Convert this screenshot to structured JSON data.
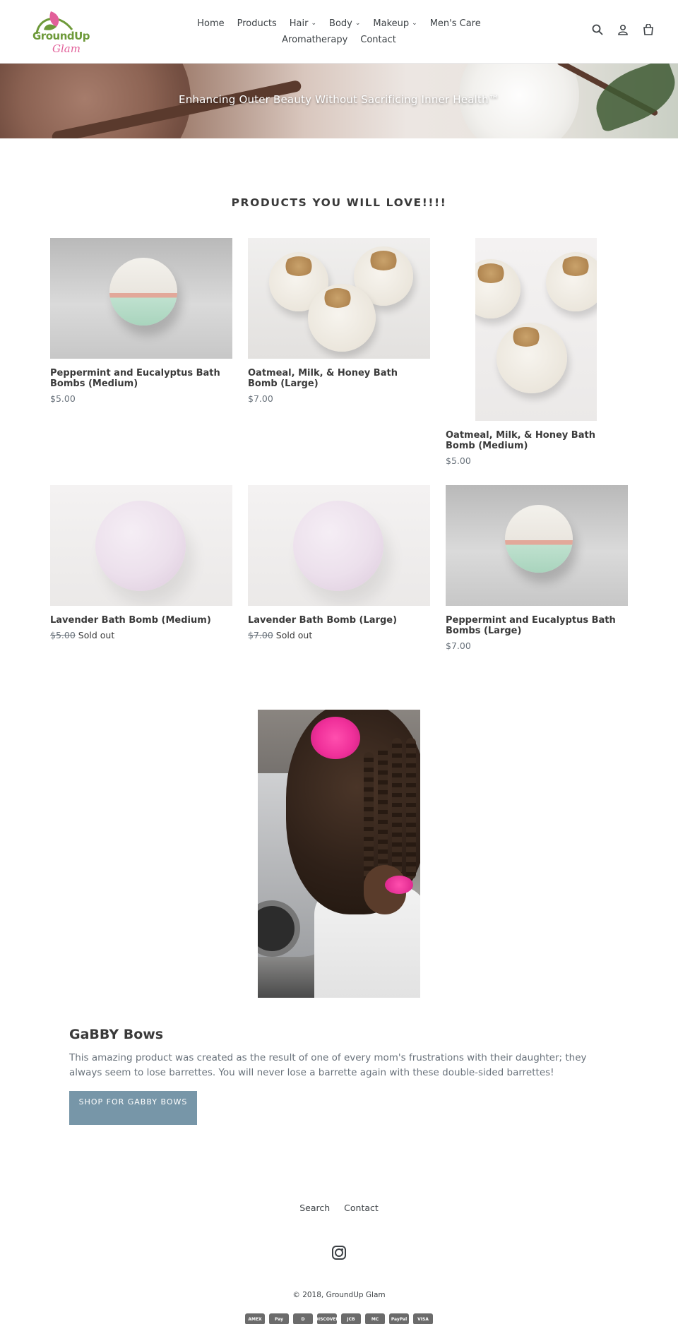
{
  "brand": {
    "logo_line1": "GroundUp",
    "logo_line2": "Glam"
  },
  "nav": {
    "items": [
      {
        "label": "Home",
        "dropdown": false
      },
      {
        "label": "Products",
        "dropdown": false
      },
      {
        "label": "Hair",
        "dropdown": true
      },
      {
        "label": "Body",
        "dropdown": true
      },
      {
        "label": "Makeup",
        "dropdown": true
      },
      {
        "label": "Men's Care",
        "dropdown": false
      },
      {
        "label": "Aromatherapy",
        "dropdown": false
      },
      {
        "label": "Contact",
        "dropdown": false
      }
    ]
  },
  "header_icons": [
    "search-icon",
    "account-icon",
    "cart-icon"
  ],
  "hero": {
    "text": "Enhancing Outer Beauty Without Sacrificing Inner Health™"
  },
  "products_section": {
    "title": "PRODUCTS YOU WILL LOVE!!!!",
    "products": [
      {
        "title": "Peppermint and Eucalyptus Bath Bombs (Medium)",
        "price": "$5.00",
        "compare_price": "",
        "status": ""
      },
      {
        "title": "Oatmeal, Milk, & Honey Bath Bomb (Large)",
        "price": "$7.00",
        "compare_price": "",
        "status": ""
      },
      {
        "title": "Oatmeal, Milk, & Honey Bath Bomb (Medium)",
        "price": "$5.00",
        "compare_price": "",
        "status": ""
      },
      {
        "title": "Lavender Bath Bomb (Medium)",
        "price": "",
        "compare_price": "$5.00",
        "status": "Sold out"
      },
      {
        "title": "Lavender Bath Bomb (Large)",
        "price": "",
        "compare_price": "$7.00",
        "status": "Sold out"
      },
      {
        "title": "Peppermint and Eucalyptus Bath Bombs (Large)",
        "price": "$7.00",
        "compare_price": "",
        "status": ""
      }
    ]
  },
  "feature": {
    "title": "GaBBY Bows",
    "text": "This amazing product was created as the result of one of every mom's frustrations with their daughter; they always seem to lose barrettes.  You will never lose a barrette again with these double-sided barrettes!",
    "button": "SHOP FOR GABBY BOWS"
  },
  "footer": {
    "links": [
      "Search",
      "Contact"
    ],
    "social_icon": "instagram-icon",
    "copyright": "© 2018, GroundUp Glam",
    "payments": [
      "AMEX",
      "Pay",
      "D",
      "DISCOVER",
      "JCB",
      "MC",
      "PayPal",
      "VISA"
    ]
  },
  "colors": {
    "accent_button": "#7796a8",
    "logo_green": "#6e9a3a",
    "logo_pink": "#e2609a",
    "text": "#3a3a3a",
    "muted": "#69727b"
  }
}
